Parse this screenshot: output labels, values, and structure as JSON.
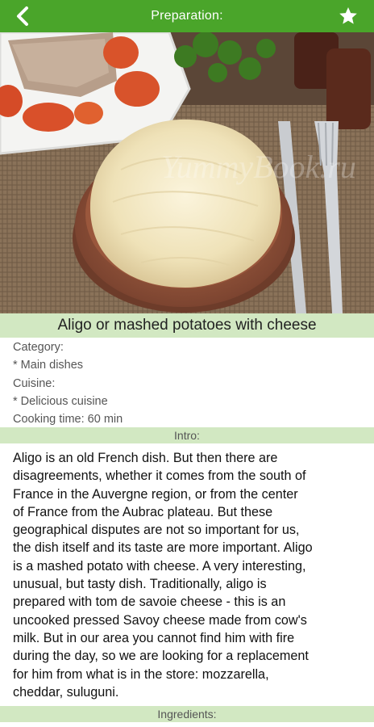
{
  "header": {
    "title": "Preparation:",
    "back_icon": "back-arrow-icon",
    "favorite_icon": "star-icon"
  },
  "photo": {
    "watermark": "YummyBook.ru"
  },
  "recipe": {
    "title": "Aligo or mashed potatoes with cheese",
    "category_label": "Category:",
    "category_value": "* Main dishes",
    "cuisine_label": "Cuisine:",
    "cuisine_value": "* Delicious cuisine",
    "cooking_time": "Cooking time: 60 min"
  },
  "sections": {
    "intro_label": "Intro:",
    "ingredients_label": "Ingredients:"
  },
  "intro_lines": [
    "Aligo is an old French dish. But then there are",
    "disagreements, whether it comes from the south of",
    "France in the Auvergne region, or from the center",
    "of France from the Aubrac plateau. But these",
    "geographical disputes are not so important for us,",
    "the dish itself and its taste are more important. Aligo",
    "is a mashed potato with cheese. A very interesting,",
    "unusual, but tasty dish. Traditionally, aligo is",
    "prepared with tom de savoie cheese - this is an",
    "uncooked pressed Savoy cheese made from cow's",
    "milk. But in our area you cannot find him with fire",
    "during the day, so we are looking for a replacement",
    "for him from what is in the store: mozzarella,",
    "cheddar, suluguni."
  ],
  "colors": {
    "header_green": "#4aa52a",
    "section_green": "#d2e8c2"
  }
}
